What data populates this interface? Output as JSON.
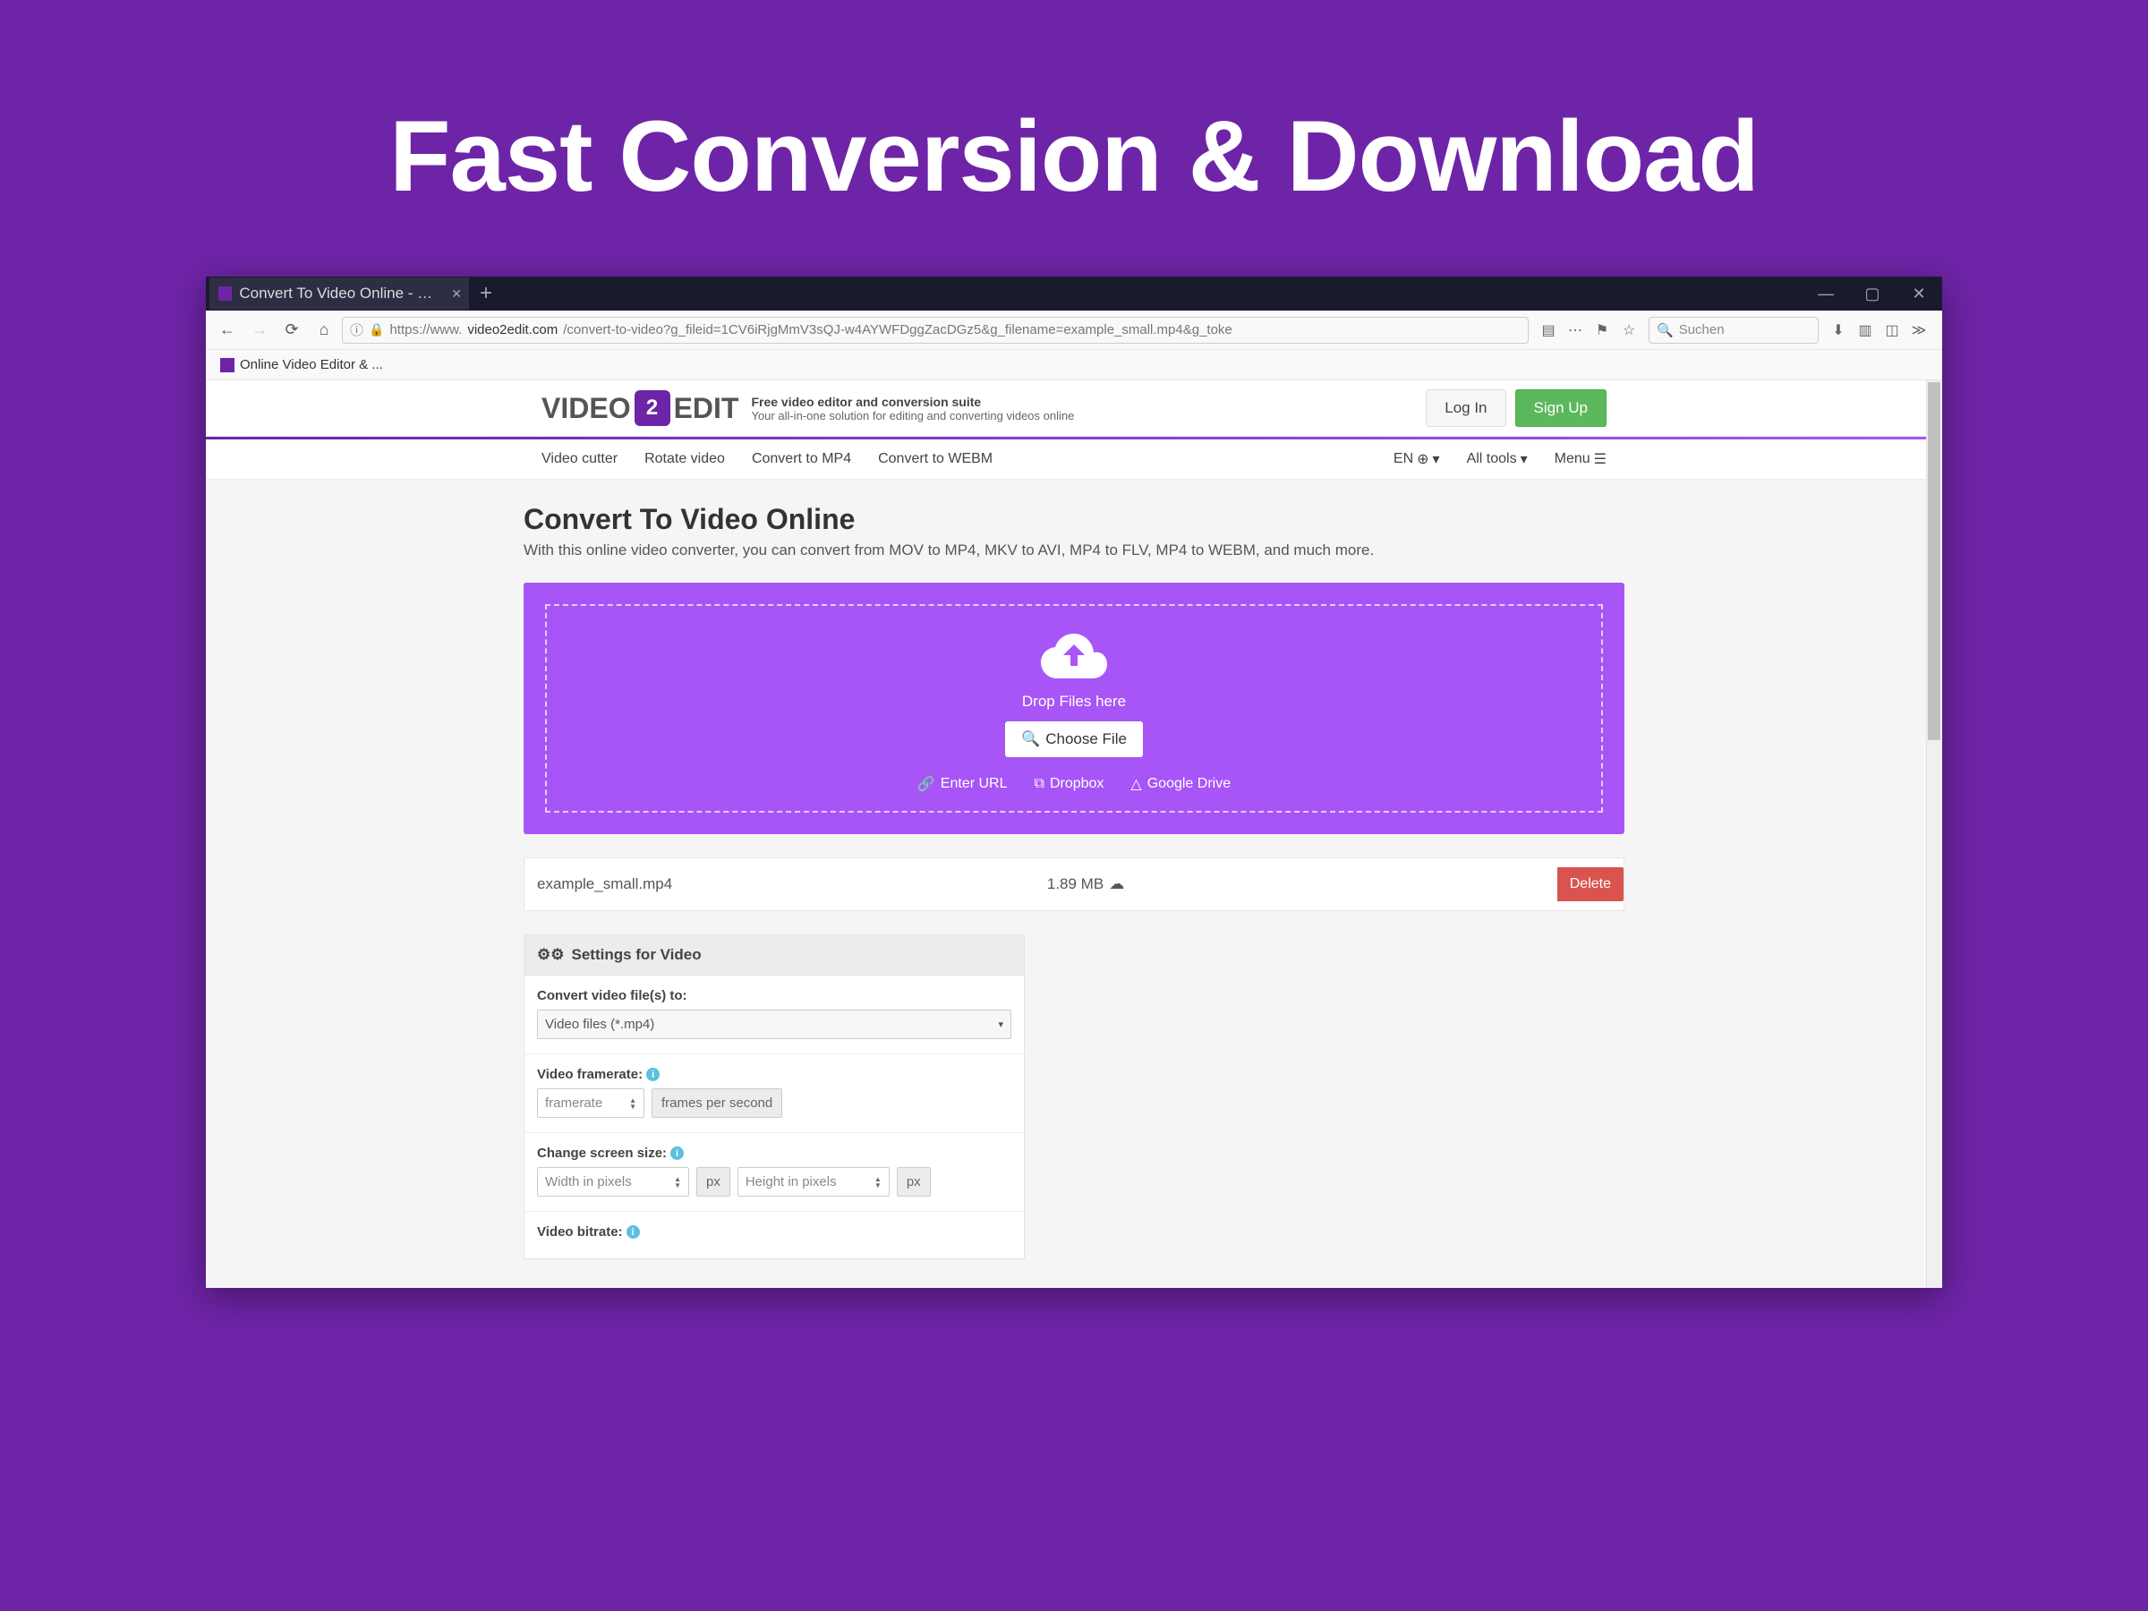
{
  "hero": {
    "title": "Fast Conversion & Download"
  },
  "browser": {
    "tab_title": "Convert To Video Online - Free",
    "url_prefix": "https://www.",
    "url_domain": "video2edit.com",
    "url_path": "/convert-to-video?g_fileid=1CV6iRjgMmV3sQJ-w4AYWFDggZacDGz5&g_filename=example_small.mp4&g_toke",
    "search_placeholder": "Suchen",
    "bookmark": "Online Video Editor & ..."
  },
  "site": {
    "logo_left": "VIDEO",
    "logo_num": "2",
    "logo_right": "EDIT",
    "tagline_title": "Free video editor and conversion suite",
    "tagline_sub": "Your all-in-one solution for editing and converting videos online",
    "login": "Log In",
    "signup": "Sign Up"
  },
  "subnav": {
    "left": [
      "Video cutter",
      "Rotate video",
      "Convert to MP4",
      "Convert to WEBM"
    ],
    "lang": "EN",
    "alltools": "All tools",
    "menu": "Menu"
  },
  "page": {
    "title": "Convert To Video Online",
    "subtitle": "With this online video converter, you can convert from MOV to MP4, MKV to AVI, MP4 to FLV, MP4 to WEBM, and much more."
  },
  "dropzone": {
    "drop_text": "Drop Files here",
    "choose": "Choose File",
    "enter_url": "Enter URL",
    "dropbox": "Dropbox",
    "gdrive": "Google Drive"
  },
  "file": {
    "name": "example_small.mp4",
    "size": "1.89 MB",
    "delete": "Delete"
  },
  "settings": {
    "header": "Settings for Video",
    "convert_to_label": "Convert video file(s) to:",
    "convert_to_value": "Video files (*.mp4)",
    "framerate_label": "Video framerate:",
    "framerate_placeholder": "framerate",
    "framerate_unit": "frames per second",
    "size_label": "Change screen size:",
    "width_placeholder": "Width in pixels",
    "height_placeholder": "Height in pixels",
    "px": "px",
    "bitrate_label": "Video bitrate:"
  }
}
